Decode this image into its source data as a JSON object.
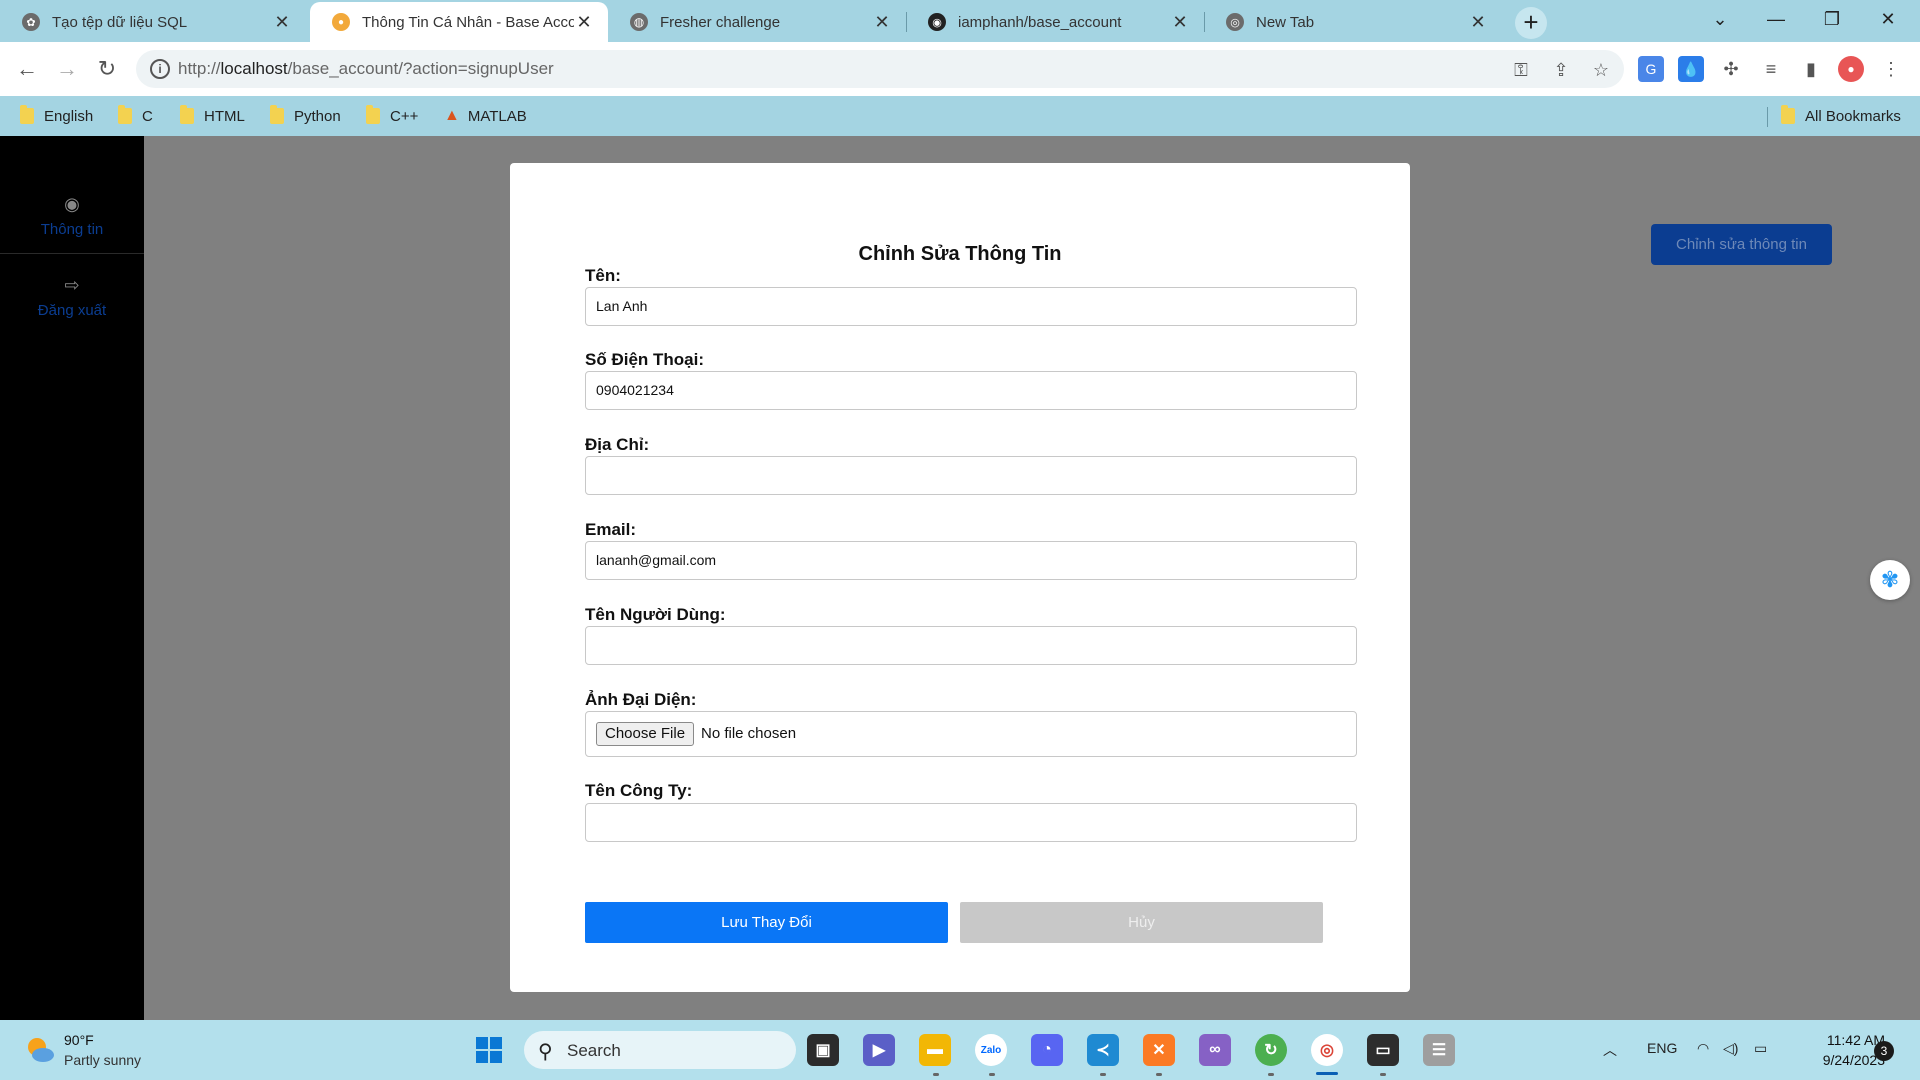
{
  "browser": {
    "tabs": [
      {
        "title": "Tạo tệp dữ liệu SQL",
        "icon": "chatgpt-icon"
      },
      {
        "title": "Thông Tin Cá Nhân - Base Account",
        "icon": "site-icon"
      },
      {
        "title": "Fresher challenge",
        "icon": "globe-icon"
      },
      {
        "title": "iamphanh/base_account",
        "icon": "github-icon"
      },
      {
        "title": "New Tab",
        "icon": "chrome-icon"
      }
    ],
    "url_prefix": "http://",
    "url_host": "localhost",
    "url_path": "/base_account/?action=signupUser",
    "bookmarks": [
      "English",
      "C",
      "HTML",
      "Python",
      "C++",
      "MATLAB"
    ],
    "all_bookmarks": "All Bookmarks"
  },
  "sidebar": {
    "items": [
      {
        "label": "Thông tin",
        "icon": "user-circle-icon"
      },
      {
        "label": "Đăng xuất",
        "icon": "logout-icon"
      }
    ]
  },
  "header": {
    "edit_button": "Chỉnh sửa thông tin"
  },
  "form": {
    "title": "Chỉnh Sửa Thông Tin",
    "name_label": "Tên:",
    "name_value": "Lan Anh",
    "phone_label": "Số Điện Thoại:",
    "phone_value": "0904021234",
    "address_label": "Địa Chỉ:",
    "address_value": "",
    "email_label": "Email:",
    "email_value": "lananh@gmail.com",
    "username_label": "Tên Người Dùng:",
    "username_value": "",
    "avatar_label": "Ảnh Đại Diện:",
    "avatar_button": "Choose File",
    "avatar_status": "No file chosen",
    "company_label": "Tên Công Ty:",
    "company_value": "",
    "save_button": "Lưu Thay Đổi",
    "cancel_button": "Hủy"
  },
  "taskbar": {
    "temperature": "90°F",
    "weather": "Partly sunny",
    "search": "Search",
    "language": "ENG",
    "time": "11:42 AM",
    "date": "9/24/2023",
    "notifications": "3",
    "zalo_label": "Zalo"
  },
  "colors": {
    "accent": "#0a76f6",
    "sidebar": "#000000",
    "edit_button": "#0b3d91",
    "cancel": "#c8c8c8",
    "tabstrip": "#a4d4e2"
  }
}
